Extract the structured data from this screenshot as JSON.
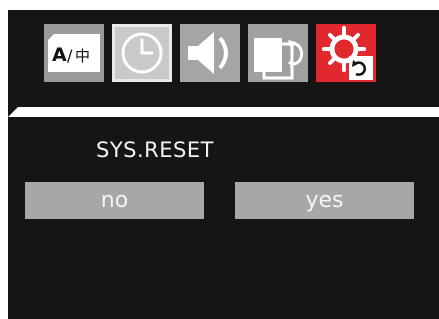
{
  "tabs": [
    {
      "name": "language",
      "icon": "language-icon",
      "label": "A/中"
    },
    {
      "name": "clock",
      "icon": "clock-icon"
    },
    {
      "name": "audio",
      "icon": "speaker-icon"
    },
    {
      "name": "input",
      "icon": "input-switch-icon"
    },
    {
      "name": "reset",
      "icon": "reset-gear-icon",
      "selected": true
    }
  ],
  "page": {
    "title": "SYS.RESET"
  },
  "options": {
    "no_label": "no",
    "yes_label": "yes"
  },
  "colors": {
    "background": "#151515",
    "tab_gray": "#a0a0a0",
    "selected_tab": "#e0282e",
    "button": "#a7a7a7"
  }
}
